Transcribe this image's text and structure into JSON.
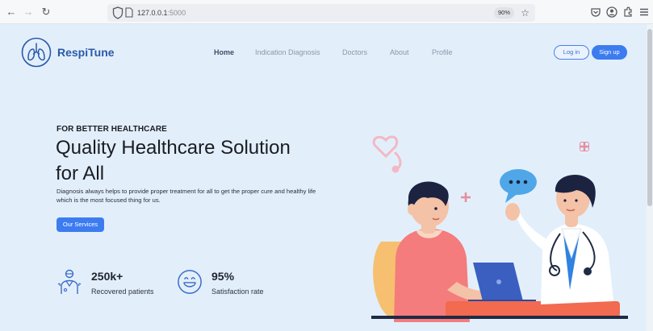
{
  "browser": {
    "url_host": "127.0.0.1",
    "url_port": ":5000",
    "zoom": "90%"
  },
  "header": {
    "brand": "RespiTune",
    "nav": [
      "Home",
      "Indication Diagnosis",
      "Doctors",
      "About",
      "Profile"
    ],
    "login_label": "Log in",
    "signup_label": "Sign up"
  },
  "hero": {
    "eyebrow": "FOR BETTER HEALTHCARE",
    "title_line1": "Quality Healthcare Solution",
    "title_line2": "for All",
    "description": "Diagnosis always helps to provide proper treatment for all to get the proper cure and healthy life which is the most focused thing for us.",
    "cta_label": "Our Services"
  },
  "stats": [
    {
      "value": "250k+",
      "label": "Recovered patients"
    },
    {
      "value": "95%",
      "label": "Satisfaction rate"
    }
  ],
  "colors": {
    "background": "#e2effb",
    "accent": "#3c7cf0",
    "brand": "#2b59a8"
  }
}
